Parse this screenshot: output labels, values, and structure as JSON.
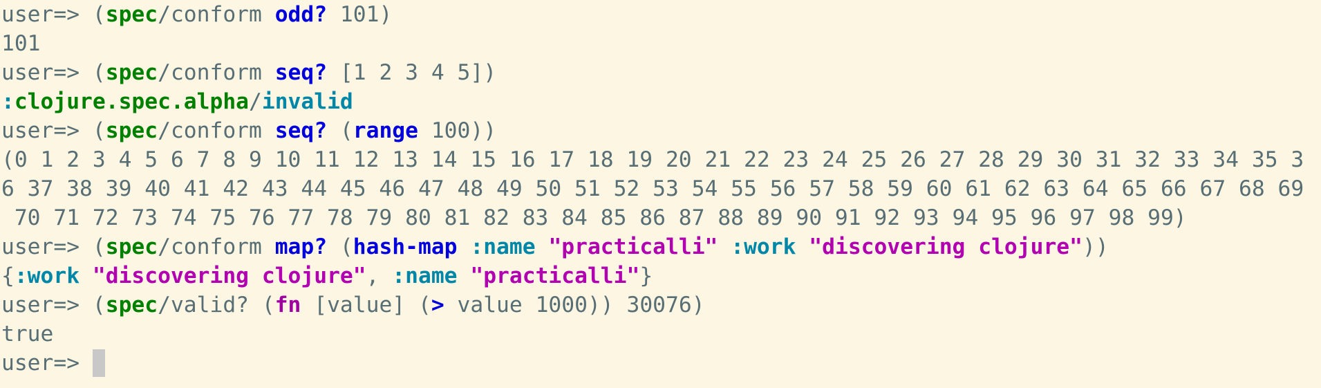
{
  "prompt": "user=> ",
  "lines": [
    {
      "kind": "input",
      "tokens": [
        {
          "t": "(",
          "c": "punct"
        },
        {
          "t": "spec",
          "c": "ns"
        },
        {
          "t": "/conform ",
          "c": "plain"
        },
        {
          "t": "odd?",
          "c": "fn-core"
        },
        {
          "t": " 101)",
          "c": "plain"
        }
      ]
    },
    {
      "kind": "output",
      "tokens": [
        {
          "t": "101",
          "c": "plain"
        }
      ]
    },
    {
      "kind": "input",
      "tokens": [
        {
          "t": "(",
          "c": "punct"
        },
        {
          "t": "spec",
          "c": "ns"
        },
        {
          "t": "/conform ",
          "c": "plain"
        },
        {
          "t": "seq?",
          "c": "fn-core"
        },
        {
          "t": " [1 2 3 4 5])",
          "c": "plain"
        }
      ]
    },
    {
      "kind": "output",
      "tokens": [
        {
          "t": ":",
          "c": "kw"
        },
        {
          "t": "clojure.spec.alpha",
          "c": "kw-ns"
        },
        {
          "t": "/",
          "c": "plain"
        },
        {
          "t": "invalid",
          "c": "kw"
        }
      ]
    },
    {
      "kind": "input",
      "tokens": [
        {
          "t": "(",
          "c": "punct"
        },
        {
          "t": "spec",
          "c": "ns"
        },
        {
          "t": "/conform ",
          "c": "plain"
        },
        {
          "t": "seq?",
          "c": "fn-core"
        },
        {
          "t": " (",
          "c": "plain"
        },
        {
          "t": "range",
          "c": "fn-core"
        },
        {
          "t": " 100))",
          "c": "plain"
        }
      ]
    },
    {
      "kind": "output",
      "tokens": [
        {
          "t": "(0 1 2 3 4 5 6 7 8 9 10 11 12 13 14 15 16 17 18 19 20 21 22 23 24 25 26 27 28 29 30 31 32 33 34 35 3",
          "c": "plain"
        }
      ]
    },
    {
      "kind": "output",
      "tokens": [
        {
          "t": "6 37 38 39 40 41 42 43 44 45 46 47 48 49 50 51 52 53 54 55 56 57 58 59 60 61 62 63 64 65 66 67 68 69",
          "c": "plain"
        }
      ]
    },
    {
      "kind": "output",
      "tokens": [
        {
          "t": " 70 71 72 73 74 75 76 77 78 79 80 81 82 83 84 85 86 87 88 89 90 91 92 93 94 95 96 97 98 99)",
          "c": "plain"
        }
      ]
    },
    {
      "kind": "input",
      "tokens": [
        {
          "t": "(",
          "c": "punct"
        },
        {
          "t": "spec",
          "c": "ns"
        },
        {
          "t": "/conform ",
          "c": "plain"
        },
        {
          "t": "map?",
          "c": "fn-core"
        },
        {
          "t": " (",
          "c": "plain"
        },
        {
          "t": "hash-map",
          "c": "fn-core"
        },
        {
          "t": " ",
          "c": "plain"
        },
        {
          "t": ":name",
          "c": "kw"
        },
        {
          "t": " ",
          "c": "plain"
        },
        {
          "t": "\"practicalli\"",
          "c": "str"
        },
        {
          "t": " ",
          "c": "plain"
        },
        {
          "t": ":work",
          "c": "kw"
        },
        {
          "t": " ",
          "c": "plain"
        },
        {
          "t": "\"discovering clojure\"",
          "c": "str"
        },
        {
          "t": "))",
          "c": "plain"
        }
      ]
    },
    {
      "kind": "output",
      "tokens": [
        {
          "t": "{",
          "c": "plain"
        },
        {
          "t": ":work",
          "c": "kw"
        },
        {
          "t": " ",
          "c": "plain"
        },
        {
          "t": "\"discovering clojure\"",
          "c": "str"
        },
        {
          "t": ", ",
          "c": "plain"
        },
        {
          "t": ":name",
          "c": "kw"
        },
        {
          "t": " ",
          "c": "plain"
        },
        {
          "t": "\"practicalli\"",
          "c": "str"
        },
        {
          "t": "}",
          "c": "plain"
        }
      ]
    },
    {
      "kind": "input",
      "tokens": [
        {
          "t": "(",
          "c": "punct"
        },
        {
          "t": "spec",
          "c": "ns"
        },
        {
          "t": "/valid? (",
          "c": "plain"
        },
        {
          "t": "fn",
          "c": "fn-macro"
        },
        {
          "t": " [value] (",
          "c": "plain"
        },
        {
          "t": ">",
          "c": "fn-core"
        },
        {
          "t": " value 1000)) 30076)",
          "c": "plain"
        }
      ]
    },
    {
      "kind": "output",
      "tokens": [
        {
          "t": "true",
          "c": "plain"
        }
      ]
    },
    {
      "kind": "input-active",
      "tokens": []
    }
  ],
  "colors": {
    "background": "#fdf6e3",
    "default_text": "#586e75",
    "namespace": "#008000",
    "core_function": "#0000dd",
    "macro": "#a000a0",
    "keyword": "#0087a8",
    "string": "#b000b0",
    "cursor": "#c8c8c8"
  }
}
